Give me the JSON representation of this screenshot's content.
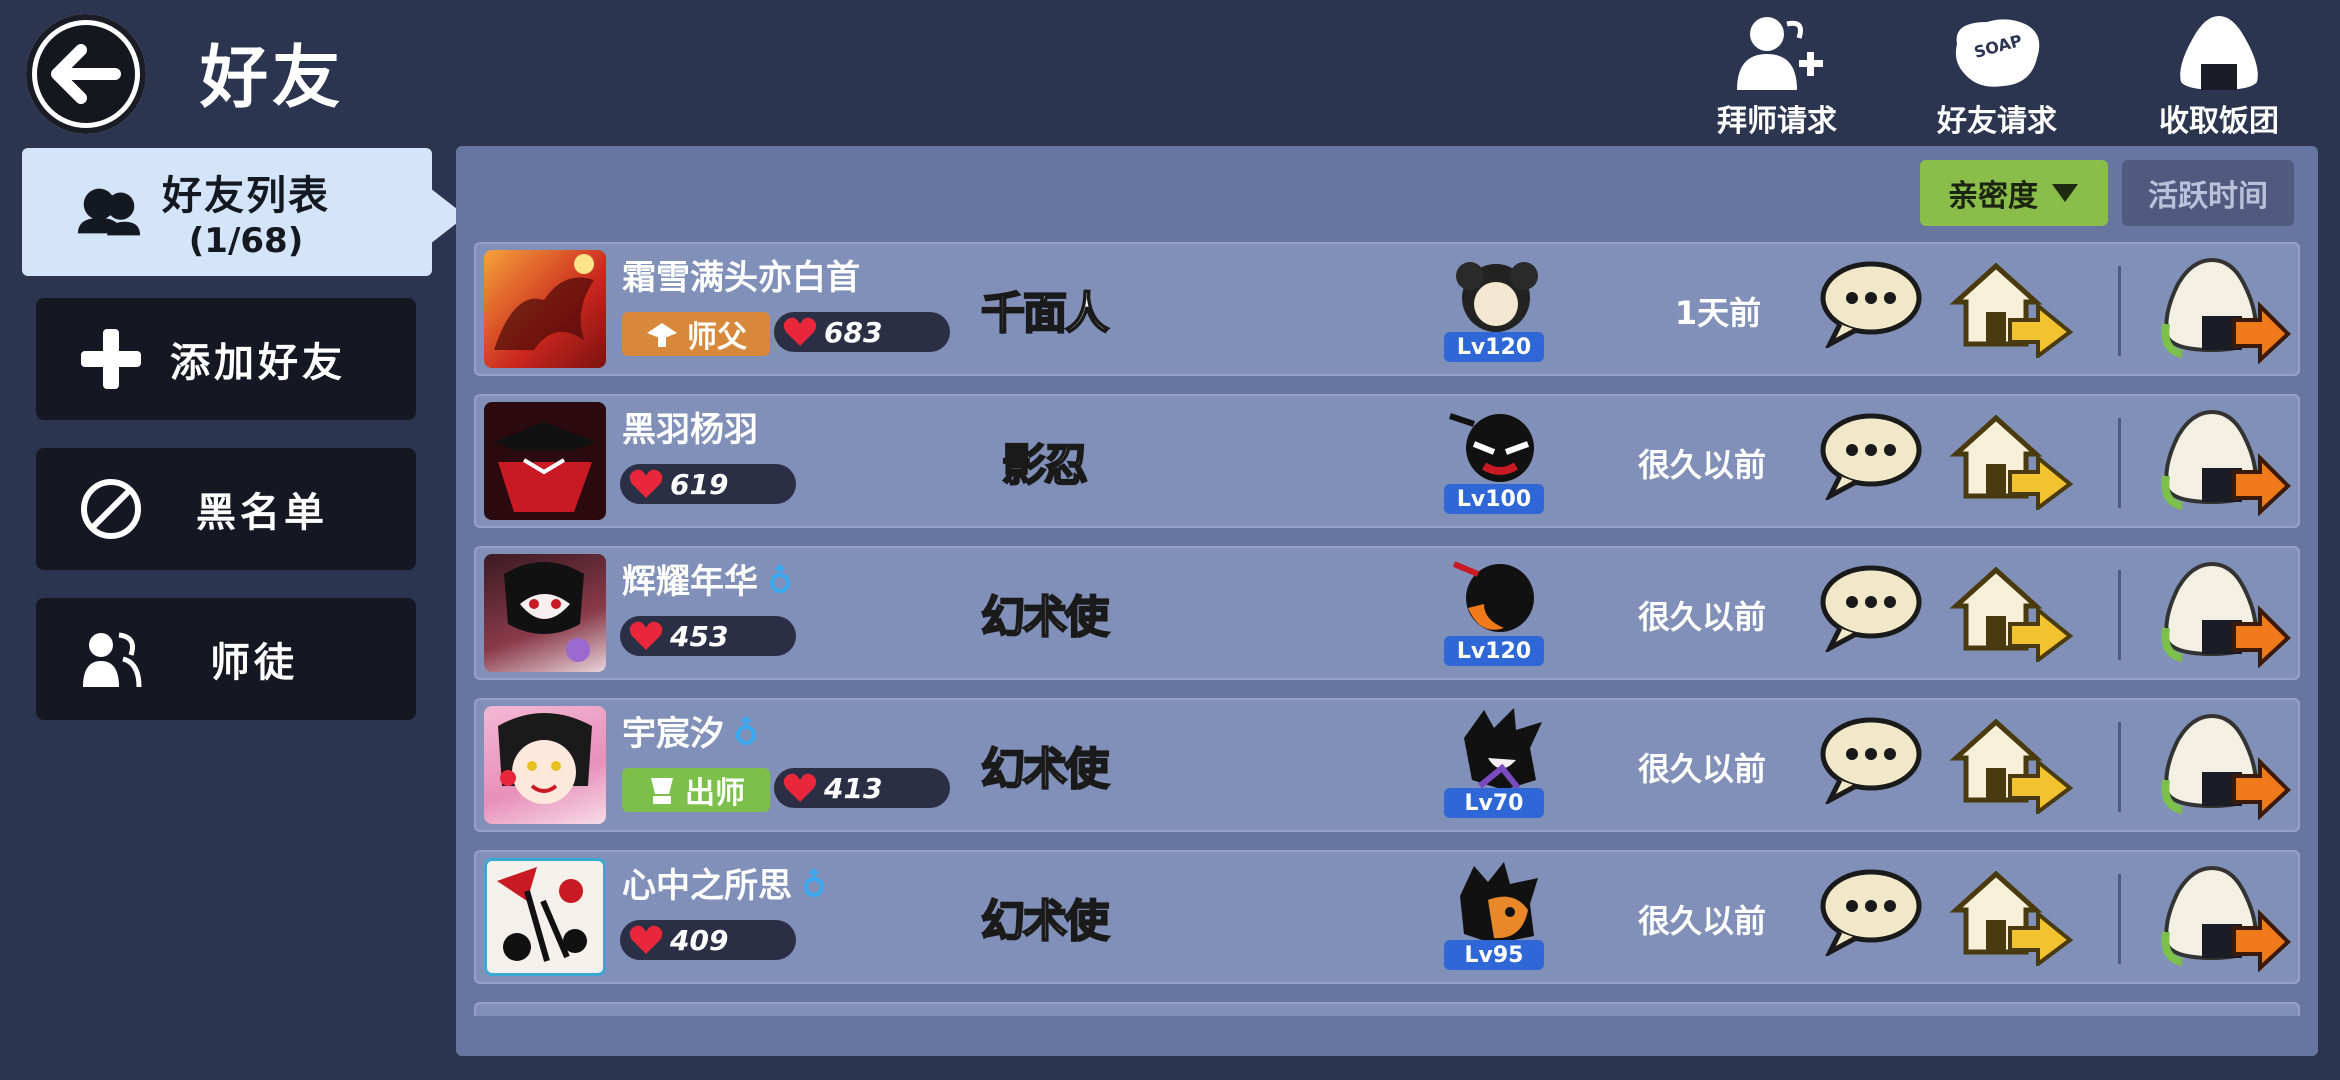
{
  "header": {
    "title": "好友",
    "actions": [
      {
        "label": "拜师请求",
        "icon": "mentor-request-icon"
      },
      {
        "label": "好友请求",
        "icon": "friend-request-icon"
      },
      {
        "label": "收取饭团",
        "icon": "riceball-collect-icon"
      }
    ]
  },
  "nav": {
    "friends_list": "好友列表",
    "friends_count": "(1/68)",
    "add_friend": "添加好友",
    "blacklist": "黑名单",
    "mentorship": "师徒"
  },
  "sort": {
    "affinity": "亲密度",
    "active_time": "活跃时间"
  },
  "friends": [
    {
      "name": "霜雪满头亦白首",
      "role": "师父",
      "affinity": "683",
      "title": "千面人",
      "level": "Lv120",
      "last_online": "1天前",
      "gender": ""
    },
    {
      "name": "黑羽杨羽",
      "role": "",
      "affinity": "619",
      "title": "影忍",
      "level": "Lv100",
      "last_online": "很久以前",
      "gender": ""
    },
    {
      "name": "辉耀年华",
      "role": "",
      "affinity": "453",
      "title": "幻术使",
      "level": "Lv120",
      "last_online": "很久以前",
      "gender": "male"
    },
    {
      "name": "宇宸汐",
      "role": "出师",
      "affinity": "413",
      "title": "幻术使",
      "level": "Lv70",
      "last_online": "很久以前",
      "gender": "male"
    },
    {
      "name": "心中之所思",
      "role": "",
      "affinity": "409",
      "title": "幻术使",
      "level": "Lv95",
      "last_online": "很久以前",
      "gender": "male"
    }
  ],
  "colors": {
    "background": "#2c3550",
    "panel": "#6776a0",
    "row": "#8190b8",
    "selected_nav": "#d4e4f9",
    "sort_active": "#8bbd4a",
    "level_badge": "#2f68d6",
    "role_master": "#d8883a",
    "role_graduated": "#7cbf4a"
  }
}
